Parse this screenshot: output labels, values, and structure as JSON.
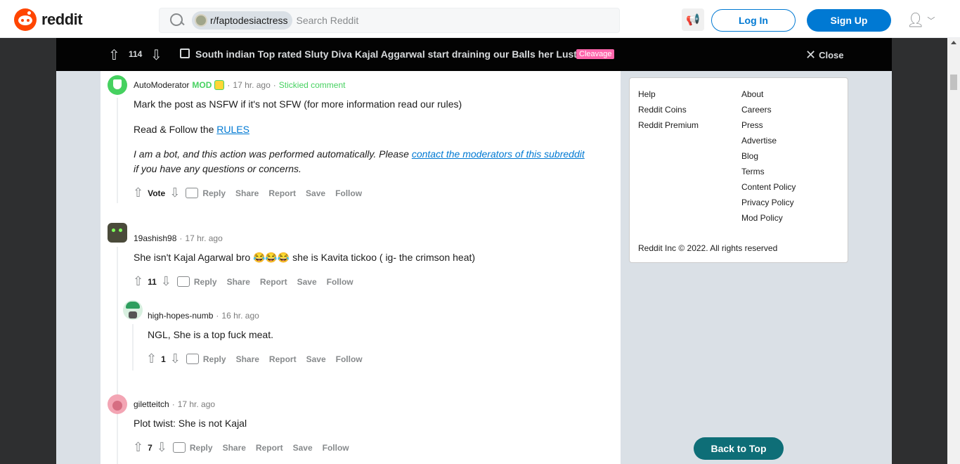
{
  "header": {
    "logo_text": "reddit",
    "subreddit_chip": "r/faptodesiactress",
    "search_placeholder": "Search Reddit",
    "login_label": "Log In",
    "signup_label": "Sign Up"
  },
  "post_bar": {
    "votes": "114",
    "title": "South indian Top rated Sluty Diva Kajal Aggarwal start draining our Balls her Lust i...",
    "flair": "Cleavage",
    "close_label": "Close"
  },
  "comments": [
    {
      "author": "AutoModerator",
      "mod_tag": "MOD",
      "time": "17 hr. ago",
      "stickied": "Stickied comment",
      "body_line1": "Mark the post as NSFW if it's not SFW (for more information read our rules)",
      "body_line2_prefix": "Read & Follow the ",
      "body_line2_link": "RULES",
      "body_line3_prefix": "I am a bot, and this action was performed automatically. Please ",
      "body_line3_link": "contact the moderators of this subreddit",
      "body_line3_suffix": "if you have any questions or concerns.",
      "votes": "Vote"
    },
    {
      "author": "19ashish98",
      "time": "17 hr. ago",
      "body": "She isn't Kajal Agarwal bro 😂😂😂 she is Kavita tickoo ( ig- the crimson heat)",
      "votes": "11"
    },
    {
      "author": "high-hopes-numb",
      "time": "16 hr. ago",
      "body": "NGL, She is a top fuck meat.",
      "votes": "1"
    },
    {
      "author": "giletteitch",
      "time": "17 hr. ago",
      "body": "Plot twist: She is not Kajal",
      "votes": "7"
    }
  ],
  "actions": {
    "reply": "Reply",
    "share": "Share",
    "report": "Report",
    "save": "Save",
    "follow": "Follow"
  },
  "sidebar": {
    "col1": [
      "Help",
      "Reddit Coins",
      "Reddit Premium"
    ],
    "col2": [
      "About",
      "Careers",
      "Press",
      "Advertise",
      "Blog",
      "Terms",
      "Content Policy",
      "Privacy Policy",
      "Mod Policy"
    ],
    "copyright": "Reddit Inc © 2022. All rights reserved"
  },
  "back_to_top": "Back to Top",
  "colors": {
    "accent": "#0079d3",
    "brand": "#ff4500",
    "mod_green": "#46d160",
    "flair_pink": "#ff66ac",
    "back_top": "#0e6e77"
  }
}
